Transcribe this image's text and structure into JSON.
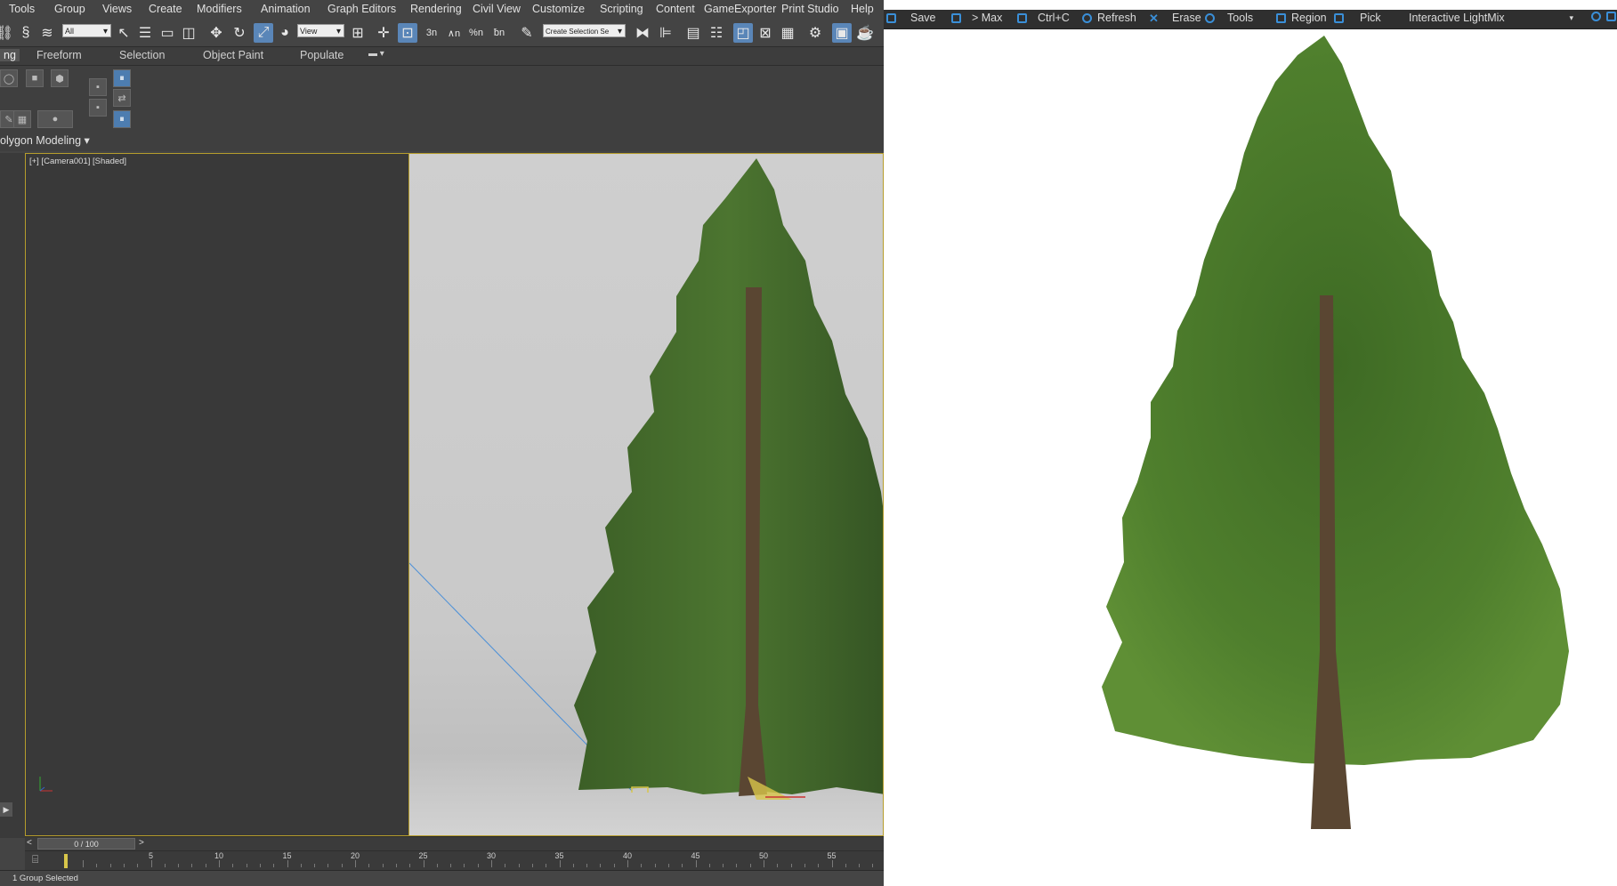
{
  "max": {
    "menu": [
      "Tools",
      "Group",
      "Views",
      "Create",
      "Modifiers",
      "Animation",
      "Graph Editors",
      "Rendering",
      "Civil View",
      "Customize",
      "Scripting",
      "Content",
      "GameExporter",
      "Print Studio",
      "Help"
    ],
    "toolbar": {
      "filter_value": "All",
      "refcoord_value": "View",
      "selection_set_placeholder": "Create Selection Se",
      "snap_labels": [
        "3n",
        "∧n",
        "%n",
        "ƀn"
      ]
    },
    "ribbon_tabs": [
      "ng",
      "Freeform",
      "Selection",
      "Object Paint",
      "Populate"
    ],
    "ribbon_panel_label": "olygon Modeling",
    "viewport_label": "[+] [Camera001] [Shaded]",
    "time_slider": "0 / 100",
    "ruler_numbers": [
      "5",
      "10",
      "15",
      "20",
      "25",
      "30",
      "35",
      "40",
      "45",
      "50",
      "55"
    ],
    "status_text": "1 Group Selected"
  },
  "vfb": {
    "buttons": [
      "Save",
      "> Max",
      "Ctrl+C",
      "Refresh",
      "Erase",
      "Tools",
      "Region",
      "Pick"
    ],
    "lightmix": "Interactive LightMix"
  },
  "colors": {
    "ui_dark": "#444444",
    "viewport_frame": "#b69d2c",
    "vray_blue": "#3a8fd8",
    "foliage": "#3e6a24",
    "trunk": "#5a4632"
  },
  "icons": [
    "select-link-icon",
    "unlink-icon",
    "bind-space-warp-icon",
    "select-object-icon",
    "select-by-name-icon",
    "rect-region-icon",
    "window-crossing-icon",
    "move-icon",
    "rotate-icon",
    "scale-icon",
    "mirror-icon",
    "align-icon",
    "layer-icon",
    "render-setup-icon",
    "render-frame-icon",
    "render-icon",
    "save-icon",
    "region-icon",
    "pick-icon"
  ]
}
